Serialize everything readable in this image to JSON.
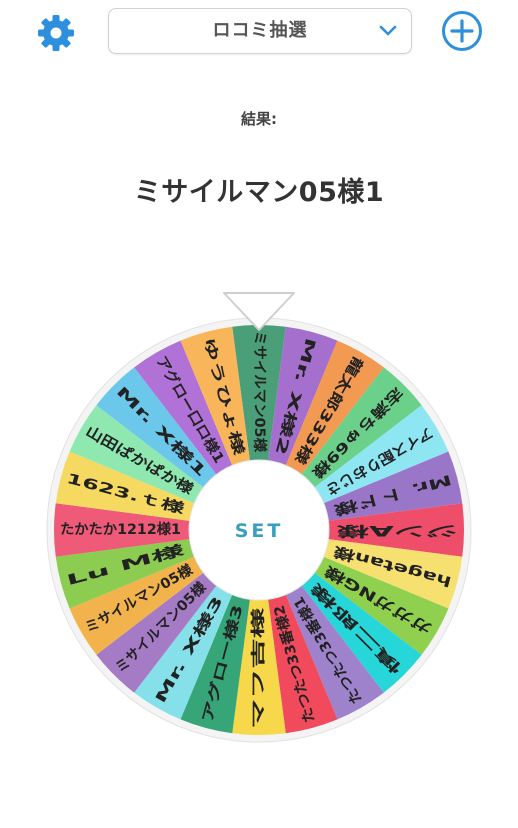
{
  "header": {
    "settings_icon": "gear-icon",
    "mode_select": {
      "selected": "ロコミ抽選"
    },
    "add_icon": "plus-circle-icon",
    "accent": "#2e90dc"
  },
  "result": {
    "label": "結果:",
    "value": "ミサイルマン05様1"
  },
  "wheel": {
    "center_label": "SET",
    "segments": [
      {
        "label": "ミサイルマン05様",
        "color": "#4a9e78"
      },
      {
        "label": "Mr. X様2",
        "color": "#a56fce"
      },
      {
        "label": "龍太郎333様",
        "color": "#f39a52"
      },
      {
        "label": "志満ちゅ69様",
        "color": "#6bd08a"
      },
      {
        "label": "アイス配りおじさ",
        "color": "#8ee6f3"
      },
      {
        "label": "Mr. トド様",
        "color": "#9a76c8"
      },
      {
        "label": "ジンA様",
        "color": "#ef4e6a"
      },
      {
        "label": "hagetan様",
        "color": "#f6e070"
      },
      {
        "label": "ガガガNG様",
        "color": "#8fd14f"
      },
      {
        "label": "慎二郎様",
        "color": "#27d6d8"
      },
      {
        "label": "たつたつ33番様1",
        "color": "#9e83cc"
      },
      {
        "label": "たつたつ33番様2",
        "color": "#f04a5c"
      },
      {
        "label": "マフ吉様",
        "color": "#f7d84a"
      },
      {
        "label": "アグロー様3",
        "color": "#36a577"
      },
      {
        "label": "Mr. X様3",
        "color": "#86e0ea"
      },
      {
        "label": "ミサイルマン05様",
        "color": "#a67bc5"
      },
      {
        "label": "ミサイルマン05様",
        "color": "#f3b34c"
      },
      {
        "label": "Lu M様",
        "color": "#8ccc50"
      },
      {
        "label": "たかたか1212様1",
        "color": "#ee5a78"
      },
      {
        "label": "1623.ｔ様",
        "color": "#f6d960"
      },
      {
        "label": "山田ぱかぱか様",
        "color": "#8ee8b0"
      },
      {
        "label": "Mr. X様1",
        "color": "#6cc8ea"
      },
      {
        "label": "アグロー口ロ様1",
        "color": "#b072d6"
      },
      {
        "label": "ゆうひょ様",
        "color": "#f9b55a"
      }
    ]
  }
}
